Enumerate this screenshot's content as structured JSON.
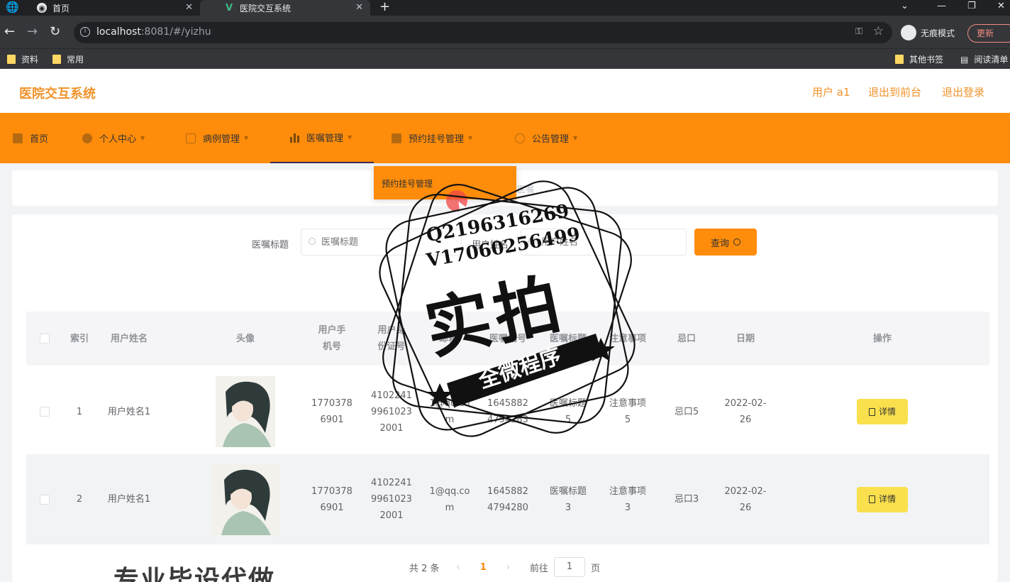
{
  "browser": {
    "tabs": [
      {
        "label": "首页"
      },
      {
        "label": "医院交互系统"
      }
    ],
    "url_host": "localhost",
    "url_rest": ":8081/#/yizhu",
    "incognito_label": "无痕模式",
    "update_label": "更新",
    "bookmarks": [
      "资料",
      "常用"
    ],
    "bookmarks_right": [
      "其他书签",
      "阅读清单"
    ]
  },
  "header": {
    "brand": "医院交互系统",
    "user": "用户 a1",
    "to_front": "退出到前台",
    "logout": "退出登录"
  },
  "menu": {
    "items": [
      {
        "label": "首页"
      },
      {
        "label": "个人中心"
      },
      {
        "label": "病例管理"
      },
      {
        "label": "医嘱管理"
      },
      {
        "label": "预约挂号管理"
      },
      {
        "label": "公告管理"
      }
    ],
    "dropdown_item": "预约挂号管理",
    "accent": "#ff8c0a"
  },
  "breadcrumb": {
    "text": "医嘱"
  },
  "filters": {
    "title_label": "医嘱标题",
    "title_placeholder": "医嘱标题",
    "user_label": "用户姓名",
    "user_placeholder": "用户姓名",
    "query_button": "查询"
  },
  "table": {
    "headers": [
      "索引",
      "用户姓名",
      "头像",
      "用户手机号",
      "用户身份证号",
      "邮箱",
      "医嘱编号",
      "医嘱标题",
      "注意事项",
      "忌口",
      "日期",
      "操作"
    ],
    "rows": [
      {
        "index": "1",
        "name": "用户姓名1",
        "phone": "17703786901",
        "idcard": "410224199610232001",
        "email": "1@qq.com",
        "code": "16458824794283",
        "title": "医嘱标题5",
        "notes": "注意事项5",
        "avoid": "忌口5",
        "date": "2022-02-26",
        "action": "详情"
      },
      {
        "index": "2",
        "name": "用户姓名1",
        "phone": "17703786901",
        "idcard": "410224199610232001",
        "email": "1@qq.com",
        "code": "16458824794280",
        "title": "医嘱标题3",
        "notes": "注意事项3",
        "avoid": "忌口3",
        "date": "2022-02-26",
        "action": "详情"
      }
    ]
  },
  "pagination": {
    "total": "共 2 条",
    "current": "1",
    "goto_prefix": "前往",
    "goto_value": "1",
    "goto_suffix": "页"
  },
  "watermark": {
    "qq": "Q2196316269",
    "vx": "V17060256499",
    "main": "实拍",
    "ribbon": "全微程序",
    "bottom": "专业毕设代做"
  }
}
